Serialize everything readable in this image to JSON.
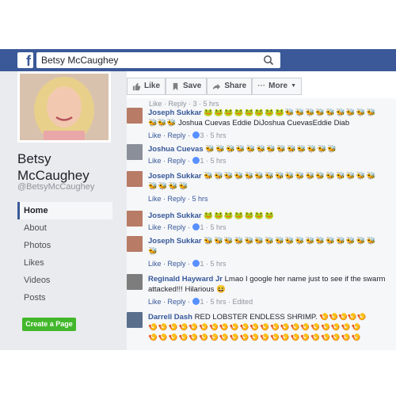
{
  "header": {
    "logo": "f",
    "search_value": "Betsy McCaughey",
    "search_icon": "search-icon"
  },
  "profile": {
    "name": "Betsy McCaughey",
    "handle": "@BetsyMcCaughey",
    "nav": [
      "Home",
      "About",
      "Photos",
      "Likes",
      "Videos",
      "Posts"
    ],
    "active_nav": "Home",
    "create_page": "Create a Page"
  },
  "actions": {
    "like": "Like",
    "save": "Save",
    "share": "Share",
    "more": "More"
  },
  "comments": {
    "cut_meta": "Like · Reply · 3 · 5 hrs",
    "items": [
      {
        "author": "Joseph Sukkar",
        "line1": "🐸🐸🐸🐸🐸🐸🐸🐸🐝🐝🐝🐝🐝🐝🐝🐝🐝",
        "line2": "🐝🐝🐝 Joshua Cuevas Eddie DiJoshua CuevasEddie Diab",
        "reply": "Like · Reply · ",
        "likes": "3",
        "time": " · 5 hrs"
      },
      {
        "author": "Joshua Cuevas",
        "line1": "🐝🐝🐝🐝🐝🐝🐝🐝🐝🐝🐝🐝🐝",
        "line2": "",
        "reply": "Like · Reply · ",
        "likes": "1",
        "time": " · 5 hrs"
      },
      {
        "author": "Joseph Sukkar",
        "line1": "🐝🐝🐝🐝🐝🐝🐝🐝🐝🐝🐝🐝🐝🐝🐝🐝🐝",
        "line2": "🐝🐝🐝🐝",
        "reply": "Like · Reply · 5 hrs",
        "likes": "",
        "time": ""
      },
      {
        "author": "Joseph Sukkar",
        "line1": "🐸🐸🐸🐸🐸🐸🐸",
        "line2": "",
        "reply": "Like · Reply · ",
        "likes": "1",
        "time": " · 5 hrs"
      },
      {
        "author": "Joseph Sukkar",
        "line1": "🐝🐝🐝🐝🐝🐝🐝🐝🐝🐝🐝🐝🐝🐝🐝🐝🐝",
        "line2": "🐝",
        "reply": "Like · Reply · ",
        "likes": "1",
        "time": " · 5 hrs"
      },
      {
        "author": "Reginald Hayward Jr",
        "line1": "Lmao I google her name just to see if the swarm",
        "line2": "attacked!!! Hilarious 😆",
        "reply": "Like · Reply · ",
        "likes": "1",
        "time": " · 5 hrs · Edited"
      },
      {
        "author": "Darrell Dash",
        "line1": "RED LOBSTER ENDLESS SHRIMP. 🍤🍤🍤🍤🍤",
        "line2": "🍤🍤🍤🍤🍤🍤🍤🍤🍤🍤🍤🍤🍤🍤🍤🍤🍤🍤🍤🍤🍤",
        "line3": "🍤🍤🍤🍤🍤🍤🍤🍤🍤🍤🍤🍤🍤🍤🍤🍤🍤🍤🍤🍤🍤",
        "reply": "",
        "likes": "",
        "time": ""
      }
    ]
  },
  "colors": {
    "brand": "#3b5998",
    "link": "#365899",
    "create": "#42b72a",
    "background": "#e9ebee"
  }
}
